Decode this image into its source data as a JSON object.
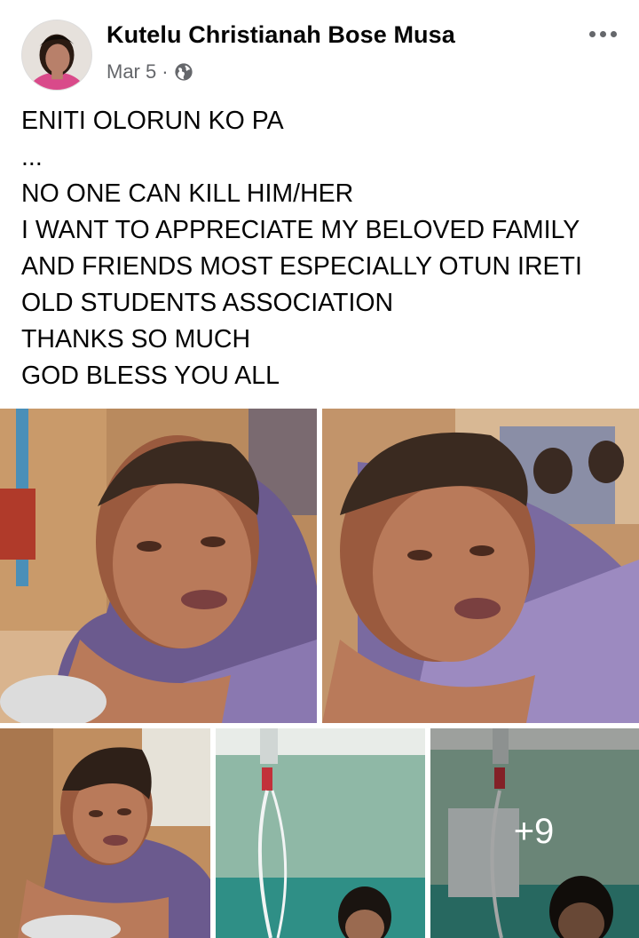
{
  "post": {
    "author": "Kutelu Christianah Bose Musa",
    "date": "Mar 5",
    "separator": "·",
    "privacy_icon": "globe-icon",
    "options_icon": "more-options-icon",
    "text_lines": [
      "ENITI OLORUN KO PA",
      "...",
      "NO ONE CAN KILL HIM/HER",
      "I WANT TO APPRECIATE MY BELOVED FAMILY",
      "AND FRIENDS MOST ESPECIALLY OTUN IRETI",
      "OLD STUDENTS ASSOCIATION",
      "THANKS SO MUCH",
      "GOD BLESS YOU ALL"
    ],
    "photos": {
      "more_count": "+9"
    }
  },
  "colors": {
    "text": "#050505",
    "secondary": "#65676b",
    "background": "#ffffff"
  }
}
